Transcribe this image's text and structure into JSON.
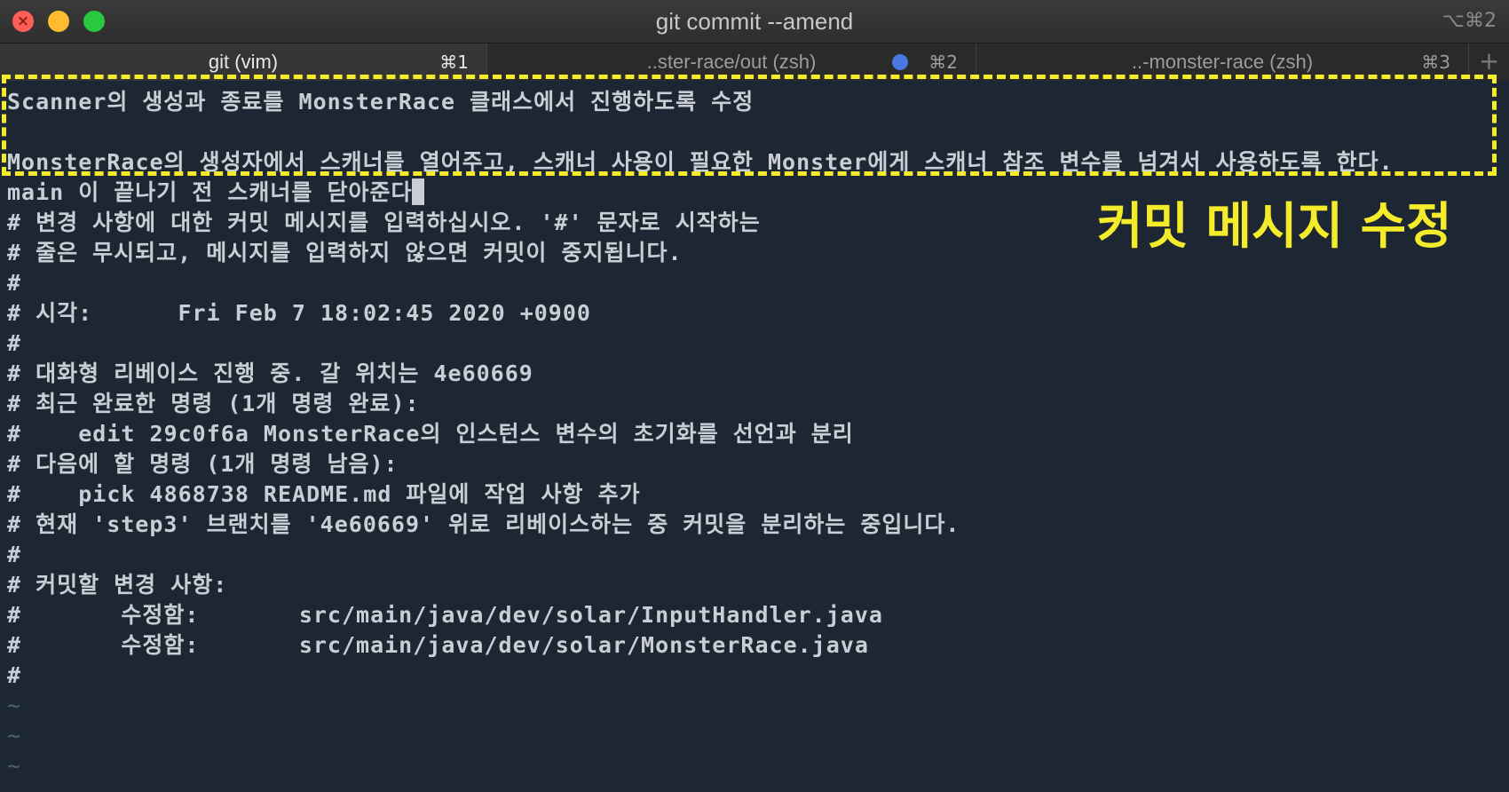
{
  "window": {
    "title": "git commit --amend",
    "shortcut": "⌥⌘2"
  },
  "tabs": [
    {
      "label": "git (vim)",
      "shortcut": "⌘1",
      "active": true
    },
    {
      "label": "..ster-race/out (zsh)",
      "shortcut": "⌘2",
      "active": false,
      "indicator_color": "#4a78e0"
    },
    {
      "label": "..-monster-race (zsh)",
      "shortcut": "⌘3",
      "active": false
    }
  ],
  "tab_add_label": "+",
  "terminal": {
    "lines": [
      "Scanner의 생성과 종료를 MonsterRace 클래스에서 진행하도록 수정",
      "",
      "MonsterRace의 생성자에서 스캐너를 열어주고, 스캐너 사용이 필요한 Monster에게 스캐너 참조 변수를 넘겨서 사용하도록 한다.",
      "main 이 끝나기 전 스캐너를 닫아준다",
      "# 변경 사항에 대한 커밋 메시지를 입력하십시오. '#' 문자로 시작하는",
      "# 줄은 무시되고, 메시지를 입력하지 않으면 커밋이 중지됩니다.",
      "#",
      "# 시각:      Fri Feb 7 18:02:45 2020 +0900",
      "#",
      "# 대화형 리베이스 진행 중. 갈 위치는 4e60669",
      "# 최근 완료한 명령 (1개 명령 완료):",
      "#    edit 29c0f6a MonsterRace의 인스턴스 변수의 초기화를 선언과 분리",
      "# 다음에 할 명령 (1개 명령 남음):",
      "#    pick 4868738 README.md 파일에 작업 사항 추가",
      "# 현재 'step3' 브랜치를 '4e60669' 위로 리베이스하는 중 커밋을 분리하는 중입니다.",
      "#",
      "# 커밋할 변경 사항:",
      "#       수정함:       src/main/java/dev/solar/InputHandler.java",
      "#       수정함:       src/main/java/dev/solar/MonsterRace.java",
      "#",
      "~",
      "~",
      "~"
    ],
    "cursor_char": "."
  },
  "annotation": {
    "text": "커밋 메시지 수정",
    "color": "#f4ec2b"
  },
  "colors": {
    "terminal_bg": "#1d2733",
    "terminal_fg": "#c9ced4",
    "highlight": "#f4ec2b"
  }
}
